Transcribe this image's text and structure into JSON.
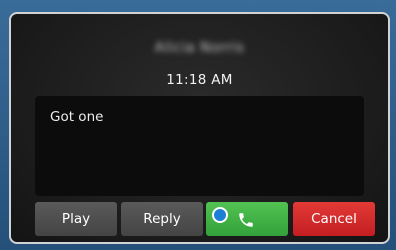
{
  "dialog": {
    "sender_name": "Alicia Norris",
    "time": "11:18 AM",
    "message": "Got one"
  },
  "buttons": {
    "play_label": "Play",
    "reply_label": "Reply",
    "call_icon": "phone-icon",
    "cancel_label": "Cancel"
  },
  "colors": {
    "call_button": "#3aab3e",
    "cancel_button": "#d42a28",
    "focus_indicator": "#1d7fd4"
  }
}
